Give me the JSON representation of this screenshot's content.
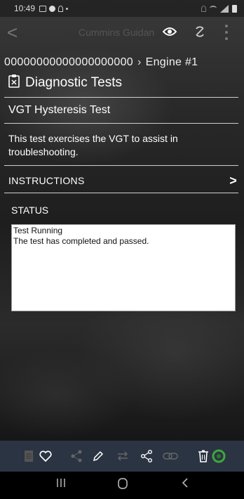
{
  "status_bar": {
    "time": "10:49"
  },
  "app_bar": {
    "title": "Cummins Guidan"
  },
  "breadcrumb": {
    "left": "00000000000000000000",
    "right": "Engine #1"
  },
  "page": {
    "title": "Diagnostic Tests"
  },
  "test": {
    "name": "VGT Hysteresis Test",
    "description": "This test exercises the VGT to assist in troubleshooting."
  },
  "instructions": {
    "label": "INSTRUCTIONS"
  },
  "status": {
    "label": "STATUS",
    "line1": "Test Running",
    "line2": "The test has completed and passed."
  },
  "colors": {
    "toolbar_bg": "#2b3442",
    "go_green": "#3ea83e"
  }
}
